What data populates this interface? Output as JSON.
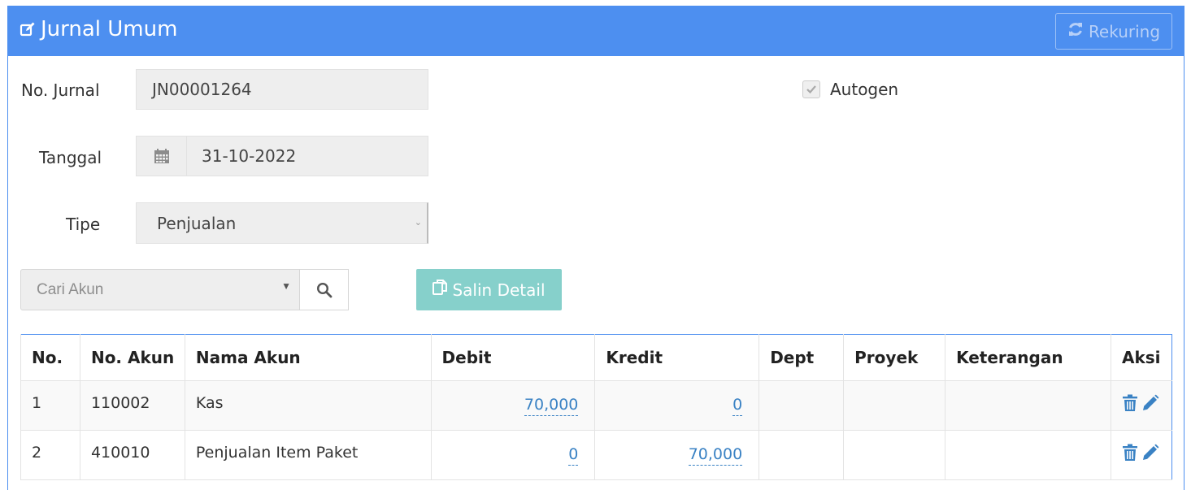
{
  "header": {
    "title": "Jurnal Umum",
    "rekuring_label": "Rekuring"
  },
  "form": {
    "no_jurnal_label": "No. Jurnal",
    "no_jurnal_value": "JN00001264",
    "tanggal_label": "Tanggal",
    "tanggal_value": "31-10-2022",
    "tipe_label": "Tipe",
    "tipe_value": "Penjualan",
    "autogen_label": "Autogen",
    "autogen_checked": true
  },
  "toolbar": {
    "cari_placeholder": "Cari Akun",
    "salin_label": "Salin Detail"
  },
  "table": {
    "headers": [
      "No.",
      "No. Akun",
      "Nama Akun",
      "Debit",
      "Kredit",
      "Dept",
      "Proyek",
      "Keterangan",
      "Aksi"
    ],
    "rows": [
      {
        "no": "1",
        "akun": "110002",
        "nama": "Kas",
        "debit": "70,000",
        "kredit": "0",
        "dept": "",
        "proyek": "",
        "ket": ""
      },
      {
        "no": "2",
        "akun": "410010",
        "nama": "Penjualan Item Paket",
        "debit": "0",
        "kredit": "70,000",
        "dept": "",
        "proyek": "",
        "ket": ""
      }
    ]
  },
  "colors": {
    "primary": "#4d8ff0",
    "teal": "#86d0cb",
    "link": "#3a82c4"
  },
  "icons": {
    "title": "edit-icon",
    "rekuring": "refresh-icon",
    "tanggal": "calendar-icon",
    "search": "search-icon",
    "salin": "copy-icon",
    "delete": "trash-icon",
    "edit": "pencil-icon"
  }
}
